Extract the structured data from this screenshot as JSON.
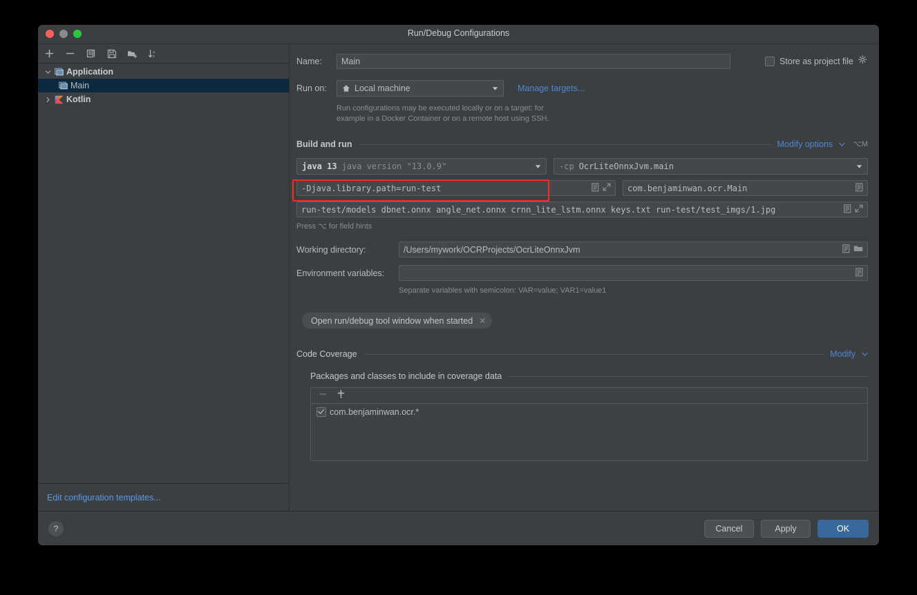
{
  "window": {
    "title": "Run/Debug Configurations",
    "traffic_lights": [
      "close",
      "minimize",
      "zoom"
    ],
    "colors": {
      "close": "#ff5f57",
      "minimize": "#8b8b8b",
      "zoom": "#28c840",
      "accent_link": "#4d88d4",
      "primary_button": "#39699c",
      "selection": "#0d293e",
      "annotation": "#ff2a1f",
      "panel": "#3c3f41",
      "field": "#45484a"
    }
  },
  "sidebar": {
    "toolbar": [
      {
        "name": "add-configuration-button",
        "icon": "plus-icon"
      },
      {
        "name": "remove-configuration-button",
        "icon": "minus-icon"
      },
      {
        "name": "copy-configuration-button",
        "icon": "copy-icon"
      },
      {
        "name": "save-configuration-button",
        "icon": "save-icon"
      },
      {
        "name": "move-into-folder-button",
        "icon": "folder-add-icon"
      },
      {
        "name": "sort-configurations-button",
        "icon": "sort-alpha-icon"
      }
    ],
    "tree": [
      {
        "label": "Application",
        "type": "group",
        "expanded": true,
        "icon": "application-icon",
        "selected": false
      },
      {
        "label": "Main",
        "type": "child",
        "icon": "application-icon",
        "selected": true
      },
      {
        "label": "Kotlin",
        "type": "group",
        "expanded": false,
        "icon": "kotlin-icon",
        "selected": false
      }
    ],
    "edit_templates_link": "Edit configuration templates..."
  },
  "form": {
    "name_label": "Name:",
    "name_value": "Main",
    "store_as_project_file_label": "Store as project file",
    "store_as_project_file_checked": false,
    "run_on_label": "Run on:",
    "run_on_value": "Local machine",
    "run_on_icon": "home-icon",
    "manage_targets_link": "Manage targets...",
    "run_on_hint_line1": "Run configurations may be executed locally or on a target: for",
    "run_on_hint_line2": "example in a Docker Container or on a remote host using SSH."
  },
  "build_and_run": {
    "section_title": "Build and run",
    "modify_options_label": "Modify options",
    "modify_options_shortcut": "⌥M",
    "jre_value_bold": "java 13",
    "jre_value_dim": "java version \"13.0.9\"",
    "jre_highlighted": true,
    "module_prefix": "-cp",
    "module_value": "OcrLiteOnnxJvm.main",
    "vm_options_value": "-Djava.library.path=run-test",
    "main_class_value": "com.benjaminwan.ocr.Main",
    "program_arguments_value": "run-test/models dbnet.onnx angle_net.onnx crnn_lite_lstm.onnx keys.txt run-test/test_imgs/1.jpg",
    "field_hint": "Press ⌥ for field hints",
    "working_directory_label": "Working directory:",
    "working_directory_value": "/Users/mywork/OCRProjects/OcrLiteOnnxJvm",
    "environment_variables_label": "Environment variables:",
    "environment_variables_value": "",
    "environment_variables_hint": "Separate variables with semicolon: VAR=value; VAR1=value1",
    "option_chip_label": "Open run/debug tool window when started"
  },
  "code_coverage": {
    "section_title": "Code Coverage",
    "modify_label": "Modify",
    "packages_section_title": "Packages and classes to include in coverage data",
    "toolbar": [
      {
        "name": "remove-package-button",
        "icon": "minus-icon",
        "enabled": false
      },
      {
        "name": "add-package-button",
        "icon": "plus-dropdown-icon",
        "enabled": true
      }
    ],
    "items": [
      {
        "label": "com.benjaminwan.ocr.*",
        "checked": true
      }
    ]
  },
  "footer": {
    "help_label": "?",
    "cancel_label": "Cancel",
    "apply_label": "Apply",
    "ok_label": "OK"
  }
}
